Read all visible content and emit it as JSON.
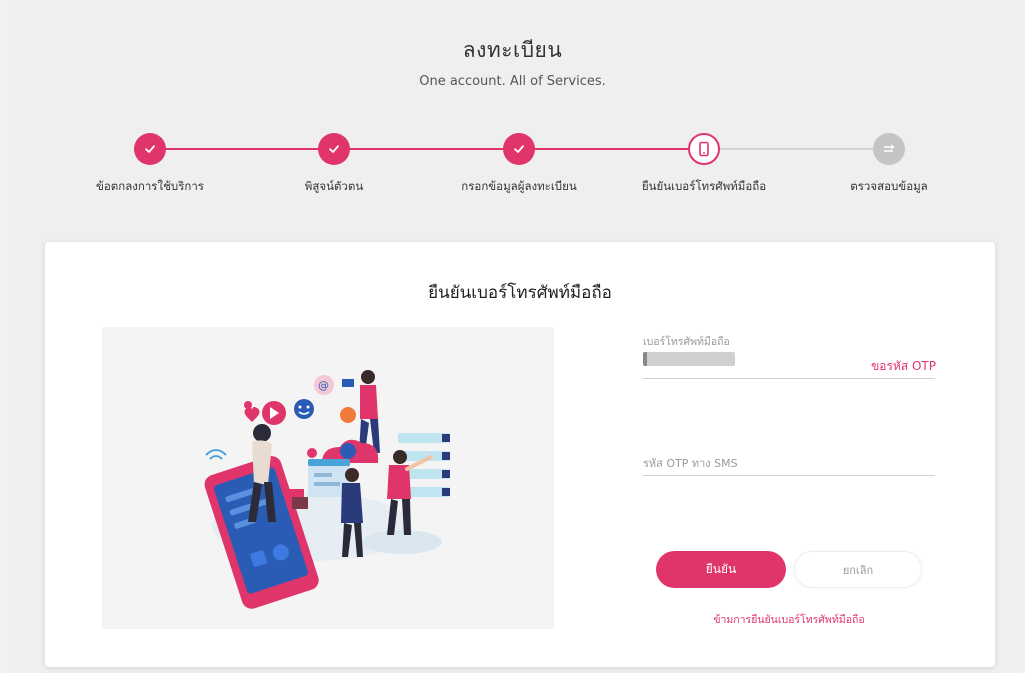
{
  "header": {
    "title": "ลงทะเบียน",
    "subtitle": "One account. All of Services."
  },
  "stepper": {
    "steps": [
      {
        "label": "ข้อตกลงการใช้บริการ",
        "status": "done",
        "icon": "check-icon"
      },
      {
        "label": "พิสูจน์ตัวตน",
        "status": "done",
        "icon": "check-icon"
      },
      {
        "label": "กรอกข้อมูลผู้ลงทะเบียน",
        "status": "done",
        "icon": "check-icon"
      },
      {
        "label": "ยืนยันเบอร์โทรศัพท์มือถือ",
        "status": "active",
        "icon": "mobile-phone-icon"
      },
      {
        "label": "ตรวจสอบข้อมูล",
        "status": "pending",
        "icon": "review-icon"
      }
    ]
  },
  "card": {
    "title": "ยืนยันเบอร์โทรศัพท์มือถือ",
    "phone_field": {
      "label": "เบอร์โทรศัพท์มือถือ",
      "request_otp_label": "ขอรหัส OTP"
    },
    "otp_field": {
      "placeholder": "รหัส OTP ทาง SMS"
    },
    "confirm_label": "ยืนยัน",
    "cancel_label": "ยกเลิก",
    "skip_label": "ข้ามการยืนยันเบอร์โทรศัพท์มือถือ"
  },
  "colors": {
    "accent": "#e0356b",
    "pending": "#c4c4c4",
    "background": "#efefef"
  }
}
